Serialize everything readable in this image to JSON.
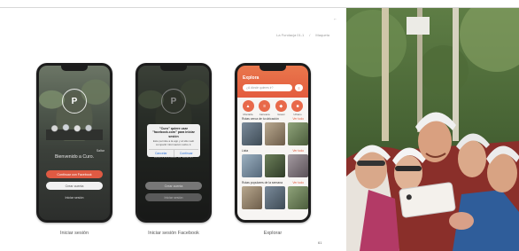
{
  "header": {
    "breadcrumb_left": "La Fundacja 01-1",
    "breadcrumb_right": "Maqueta"
  },
  "page_number": "61",
  "screens": [
    {
      "caption": "Iniciar sesión",
      "skip_label": "Saltar",
      "welcome": "Bienvenido a Curo.",
      "buttons": [
        "Continuar con Facebook",
        "Crear cuenta",
        "Iniciar sesión"
      ]
    },
    {
      "caption": "Iniciar sesión Facebook",
      "welcome": "Bienvenido a Curo.",
      "dialog_title": "\"Curo\" quiere usar \"facebook.com\" para iniciar sesión",
      "dialog_body": "Esto permite a la app y al sitio web compartir información sobre ti.",
      "dialog_cancel": "Cancelar",
      "dialog_continue": "Continuar",
      "buttons": [
        "Crear cuenta",
        "Iniciar sesión"
      ]
    },
    {
      "caption": "Explorar",
      "title": "Explora",
      "search_placeholder": "¿A dónde quieres ir?",
      "filter_icon": "sliders-icon",
      "categories": [
        "Montaña",
        "Carretera",
        "Gravel",
        "Urbano"
      ],
      "sections": [
        {
          "title": "Rutas cerca de tu ubicación",
          "more": "Ver todo"
        },
        {
          "title": "Lista",
          "more": "Ver todo"
        },
        {
          "title": "Rutas populares de la semana",
          "more": "Ver todo"
        }
      ]
    }
  ],
  "colors": {
    "accent": "#e35c3f",
    "page": "#ffffff",
    "phone": "#1c1c1c"
  }
}
